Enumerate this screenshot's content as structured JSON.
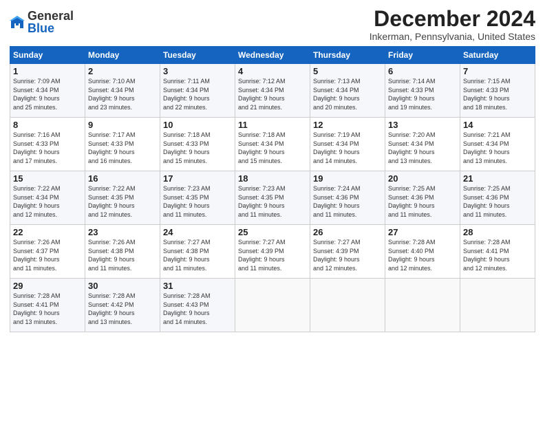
{
  "header": {
    "logo_general": "General",
    "logo_blue": "Blue",
    "month_title": "December 2024",
    "location": "Inkerman, Pennsylvania, United States"
  },
  "days_of_week": [
    "Sunday",
    "Monday",
    "Tuesday",
    "Wednesday",
    "Thursday",
    "Friday",
    "Saturday"
  ],
  "weeks": [
    [
      {
        "day": "1",
        "lines": [
          "Sunrise: 7:09 AM",
          "Sunset: 4:34 PM",
          "Daylight: 9 hours",
          "and 25 minutes."
        ]
      },
      {
        "day": "2",
        "lines": [
          "Sunrise: 7:10 AM",
          "Sunset: 4:34 PM",
          "Daylight: 9 hours",
          "and 23 minutes."
        ]
      },
      {
        "day": "3",
        "lines": [
          "Sunrise: 7:11 AM",
          "Sunset: 4:34 PM",
          "Daylight: 9 hours",
          "and 22 minutes."
        ]
      },
      {
        "day": "4",
        "lines": [
          "Sunrise: 7:12 AM",
          "Sunset: 4:34 PM",
          "Daylight: 9 hours",
          "and 21 minutes."
        ]
      },
      {
        "day": "5",
        "lines": [
          "Sunrise: 7:13 AM",
          "Sunset: 4:34 PM",
          "Daylight: 9 hours",
          "and 20 minutes."
        ]
      },
      {
        "day": "6",
        "lines": [
          "Sunrise: 7:14 AM",
          "Sunset: 4:33 PM",
          "Daylight: 9 hours",
          "and 19 minutes."
        ]
      },
      {
        "day": "7",
        "lines": [
          "Sunrise: 7:15 AM",
          "Sunset: 4:33 PM",
          "Daylight: 9 hours",
          "and 18 minutes."
        ]
      }
    ],
    [
      {
        "day": "8",
        "lines": [
          "Sunrise: 7:16 AM",
          "Sunset: 4:33 PM",
          "Daylight: 9 hours",
          "and 17 minutes."
        ]
      },
      {
        "day": "9",
        "lines": [
          "Sunrise: 7:17 AM",
          "Sunset: 4:33 PM",
          "Daylight: 9 hours",
          "and 16 minutes."
        ]
      },
      {
        "day": "10",
        "lines": [
          "Sunrise: 7:18 AM",
          "Sunset: 4:33 PM",
          "Daylight: 9 hours",
          "and 15 minutes."
        ]
      },
      {
        "day": "11",
        "lines": [
          "Sunrise: 7:18 AM",
          "Sunset: 4:34 PM",
          "Daylight: 9 hours",
          "and 15 minutes."
        ]
      },
      {
        "day": "12",
        "lines": [
          "Sunrise: 7:19 AM",
          "Sunset: 4:34 PM",
          "Daylight: 9 hours",
          "and 14 minutes."
        ]
      },
      {
        "day": "13",
        "lines": [
          "Sunrise: 7:20 AM",
          "Sunset: 4:34 PM",
          "Daylight: 9 hours",
          "and 13 minutes."
        ]
      },
      {
        "day": "14",
        "lines": [
          "Sunrise: 7:21 AM",
          "Sunset: 4:34 PM",
          "Daylight: 9 hours",
          "and 13 minutes."
        ]
      }
    ],
    [
      {
        "day": "15",
        "lines": [
          "Sunrise: 7:22 AM",
          "Sunset: 4:34 PM",
          "Daylight: 9 hours",
          "and 12 minutes."
        ]
      },
      {
        "day": "16",
        "lines": [
          "Sunrise: 7:22 AM",
          "Sunset: 4:35 PM",
          "Daylight: 9 hours",
          "and 12 minutes."
        ]
      },
      {
        "day": "17",
        "lines": [
          "Sunrise: 7:23 AM",
          "Sunset: 4:35 PM",
          "Daylight: 9 hours",
          "and 11 minutes."
        ]
      },
      {
        "day": "18",
        "lines": [
          "Sunrise: 7:23 AM",
          "Sunset: 4:35 PM",
          "Daylight: 9 hours",
          "and 11 minutes."
        ]
      },
      {
        "day": "19",
        "lines": [
          "Sunrise: 7:24 AM",
          "Sunset: 4:36 PM",
          "Daylight: 9 hours",
          "and 11 minutes."
        ]
      },
      {
        "day": "20",
        "lines": [
          "Sunrise: 7:25 AM",
          "Sunset: 4:36 PM",
          "Daylight: 9 hours",
          "and 11 minutes."
        ]
      },
      {
        "day": "21",
        "lines": [
          "Sunrise: 7:25 AM",
          "Sunset: 4:36 PM",
          "Daylight: 9 hours",
          "and 11 minutes."
        ]
      }
    ],
    [
      {
        "day": "22",
        "lines": [
          "Sunrise: 7:26 AM",
          "Sunset: 4:37 PM",
          "Daylight: 9 hours",
          "and 11 minutes."
        ]
      },
      {
        "day": "23",
        "lines": [
          "Sunrise: 7:26 AM",
          "Sunset: 4:38 PM",
          "Daylight: 9 hours",
          "and 11 minutes."
        ]
      },
      {
        "day": "24",
        "lines": [
          "Sunrise: 7:27 AM",
          "Sunset: 4:38 PM",
          "Daylight: 9 hours",
          "and 11 minutes."
        ]
      },
      {
        "day": "25",
        "lines": [
          "Sunrise: 7:27 AM",
          "Sunset: 4:39 PM",
          "Daylight: 9 hours",
          "and 11 minutes."
        ]
      },
      {
        "day": "26",
        "lines": [
          "Sunrise: 7:27 AM",
          "Sunset: 4:39 PM",
          "Daylight: 9 hours",
          "and 12 minutes."
        ]
      },
      {
        "day": "27",
        "lines": [
          "Sunrise: 7:28 AM",
          "Sunset: 4:40 PM",
          "Daylight: 9 hours",
          "and 12 minutes."
        ]
      },
      {
        "day": "28",
        "lines": [
          "Sunrise: 7:28 AM",
          "Sunset: 4:41 PM",
          "Daylight: 9 hours",
          "and 12 minutes."
        ]
      }
    ],
    [
      {
        "day": "29",
        "lines": [
          "Sunrise: 7:28 AM",
          "Sunset: 4:41 PM",
          "Daylight: 9 hours",
          "and 13 minutes."
        ]
      },
      {
        "day": "30",
        "lines": [
          "Sunrise: 7:28 AM",
          "Sunset: 4:42 PM",
          "Daylight: 9 hours",
          "and 13 minutes."
        ]
      },
      {
        "day": "31",
        "lines": [
          "Sunrise: 7:28 AM",
          "Sunset: 4:43 PM",
          "Daylight: 9 hours",
          "and 14 minutes."
        ]
      },
      {
        "day": "",
        "lines": []
      },
      {
        "day": "",
        "lines": []
      },
      {
        "day": "",
        "lines": []
      },
      {
        "day": "",
        "lines": []
      }
    ]
  ]
}
